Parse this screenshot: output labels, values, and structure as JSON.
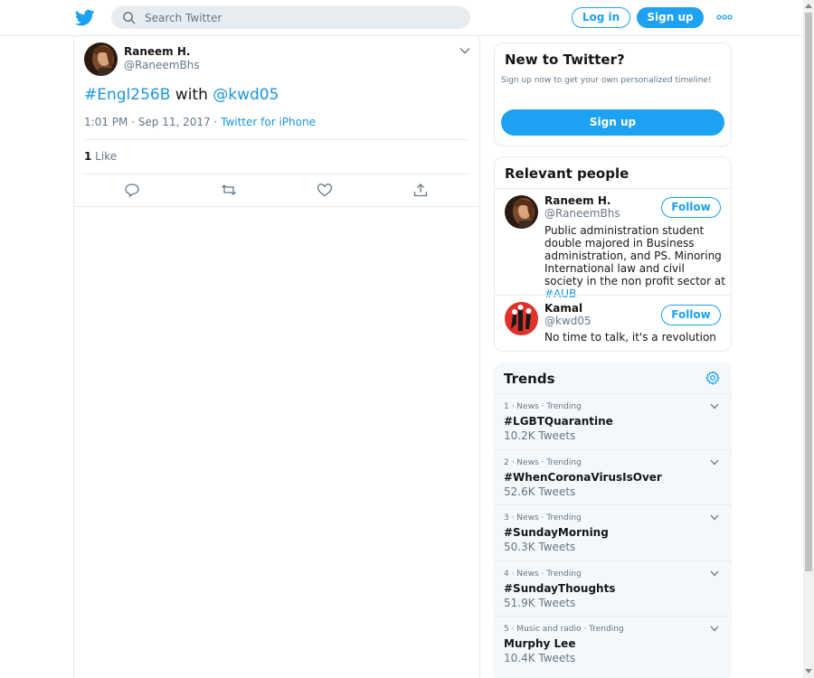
{
  "header": {
    "search_placeholder": "Search Twitter",
    "login_label": "Log in",
    "signup_label": "Sign up",
    "brand_color": "#1da1f2"
  },
  "tweet": {
    "author_name": "Raneem H.",
    "author_handle": "@RaneemBhs",
    "text_hashtag": "#Engl256B",
    "text_middle": " with ",
    "text_mention": "@kwd05",
    "time": "1:01 PM · Sep 11, 2017 · ",
    "source": "Twitter for iPhone",
    "likes_count": "1",
    "likes_label": " Like",
    "actions": [
      "reply-icon",
      "retweet-icon",
      "like-icon",
      "share-icon"
    ]
  },
  "new_to_twitter": {
    "title": "New to Twitter?",
    "subtitle": "Sign up now to get your own personalized timeline!",
    "signup_label": "Sign up"
  },
  "relevant_people": {
    "title": "Relevant people",
    "people": [
      {
        "name": "Raneem H.",
        "handle": "@RaneemBhs",
        "bio": "Public administration student double majored in Business administration, and PS. Minoring International law and civil society in the non profit sector at ",
        "bio_link": "#AUB",
        "follow_label": "Follow"
      },
      {
        "name": "Kamal",
        "handle": "@kwd05",
        "bio": "No time to talk, it's a revolution",
        "follow_label": "Follow"
      }
    ]
  },
  "trends": {
    "title": "Trends",
    "items": [
      {
        "meta": "1 · News · Trending",
        "name": "#LGBTQuarantine",
        "count": "10.2K Tweets"
      },
      {
        "meta": "2 · News · Trending",
        "name": "#WhenCoronaVirusIsOver",
        "count": "52.6K Tweets"
      },
      {
        "meta": "3 · News · Trending",
        "name": "#SundayMorning",
        "count": "50.3K Tweets"
      },
      {
        "meta": "4 · News · Trending",
        "name": "#SundayThoughts",
        "count": "51.9K Tweets"
      },
      {
        "meta": "5 · Music and radio · Trending",
        "name": "Murphy Lee",
        "count": "10.4K Tweets"
      }
    ]
  }
}
